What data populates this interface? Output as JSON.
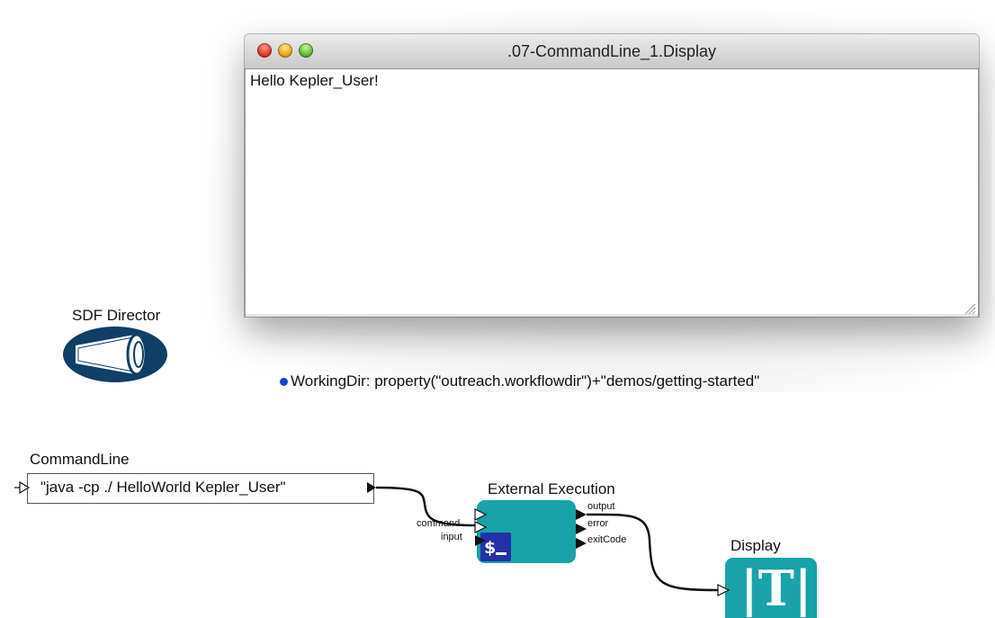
{
  "display_window": {
    "title": ".07-CommandLine_1.Display",
    "output_text": "Hello Kepler_User!"
  },
  "director": {
    "label": "SDF Director",
    "icon": "megaphone-icon"
  },
  "working_dir": {
    "text": "WorkingDir: property(\"outreach.workflowdir\")+\"demos/getting-started\"",
    "dot_color": "#1b3fd9"
  },
  "command_line": {
    "label": "CommandLine",
    "value": "\"java -cp ./ HelloWorld Kepler_User\""
  },
  "external_execution": {
    "label": "External Execution",
    "input_ports": [
      "command",
      "input"
    ],
    "output_ports": [
      "output",
      "error",
      "exitCode"
    ],
    "icon": "shell-icon",
    "icon_text": "$_",
    "color": "#17a3a7"
  },
  "display_actor": {
    "label": "Display",
    "icon_text": "|T|",
    "color": "#17a3a7"
  },
  "colors": {
    "actor_teal": "#17a3a7",
    "director_navy": "#0f3e67",
    "shell_blue": "#2231a8"
  }
}
